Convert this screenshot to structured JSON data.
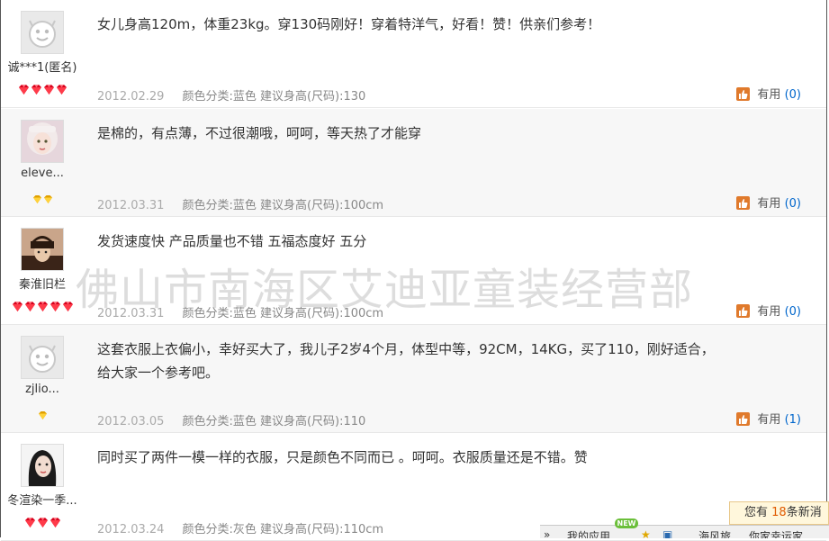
{
  "reviews": [
    {
      "username": "诚***1(匿名)",
      "avatar": "default-smiley-avatar",
      "rank_icon": "red-gem-icon",
      "rank_count": 4,
      "content": "女儿身高120m，体重23kg。穿130码刚好！穿着特洋气，好看！赞！供亲们参考！",
      "date": "2012.02.29",
      "spec": "颜色分类:蓝色  建议身高(尺码):130",
      "useful_label": "有用",
      "useful_count": "(0)"
    },
    {
      "username": "eleve...",
      "avatar": "girl-photo-avatar",
      "rank_icon": "gold-gem-icon",
      "rank_count": 2,
      "content": "是棉的，有点薄，不过很潮哦，呵呵，等天热了才能穿",
      "date": "2012.03.31",
      "spec": "颜色分类:蓝色  建议身高(尺码):100cm",
      "useful_label": "有用",
      "useful_count": "(0)"
    },
    {
      "username": "秦淮旧栏",
      "avatar": "hat-photo-avatar",
      "rank_icon": "red-gem-icon",
      "rank_count": 5,
      "content": "发货速度快 产品质量也不错 五福态度好 五分",
      "date": "2012.03.31",
      "spec": "颜色分类:蓝色  建议身高(尺码):100cm",
      "useful_label": "有用",
      "useful_count": "(0)"
    },
    {
      "username": "zjlio...",
      "avatar": "default-smiley-avatar",
      "rank_icon": "gold-gem-icon",
      "rank_count": 1,
      "content": "这套衣服上衣偏小，幸好买大了，我儿子2岁4个月，体型中等，92CM，14KG，买了110，刚好适合，给大家一个参考吧。",
      "date": "2012.03.05",
      "spec": "颜色分类:蓝色  建议身高(尺码):110",
      "useful_label": "有用",
      "useful_count": "(1)"
    },
    {
      "username": "冬渲染一季...",
      "avatar": "woman-photo-avatar",
      "rank_icon": "red-gem-icon",
      "rank_count": 3,
      "content": "同时买了两件一模一样的衣服，只是颜色不同而已 。呵呵。衣服质量还是不错。赞",
      "date": "2012.03.24",
      "spec": "颜色分类:灰色  建议身高(尺码):110cm",
      "useful_label": "有用",
      "useful_count": "(0)"
    }
  ],
  "watermark": "佛山市南海区艾迪亚童装经营部",
  "notification": {
    "prefix": "您有",
    "count": "18",
    "suffix": "条新消"
  },
  "toolbar": {
    "badge": "NEW",
    "items": [
      "»",
      "我的应用",
      "★",
      "▣",
      "海风旅",
      "你家幸运家"
    ]
  },
  "colors": {
    "link_blue": "#0066cc",
    "thumb_orange": "#e07a2c",
    "gem_red": "#d6001c",
    "gem_gold": "#f0b400"
  }
}
